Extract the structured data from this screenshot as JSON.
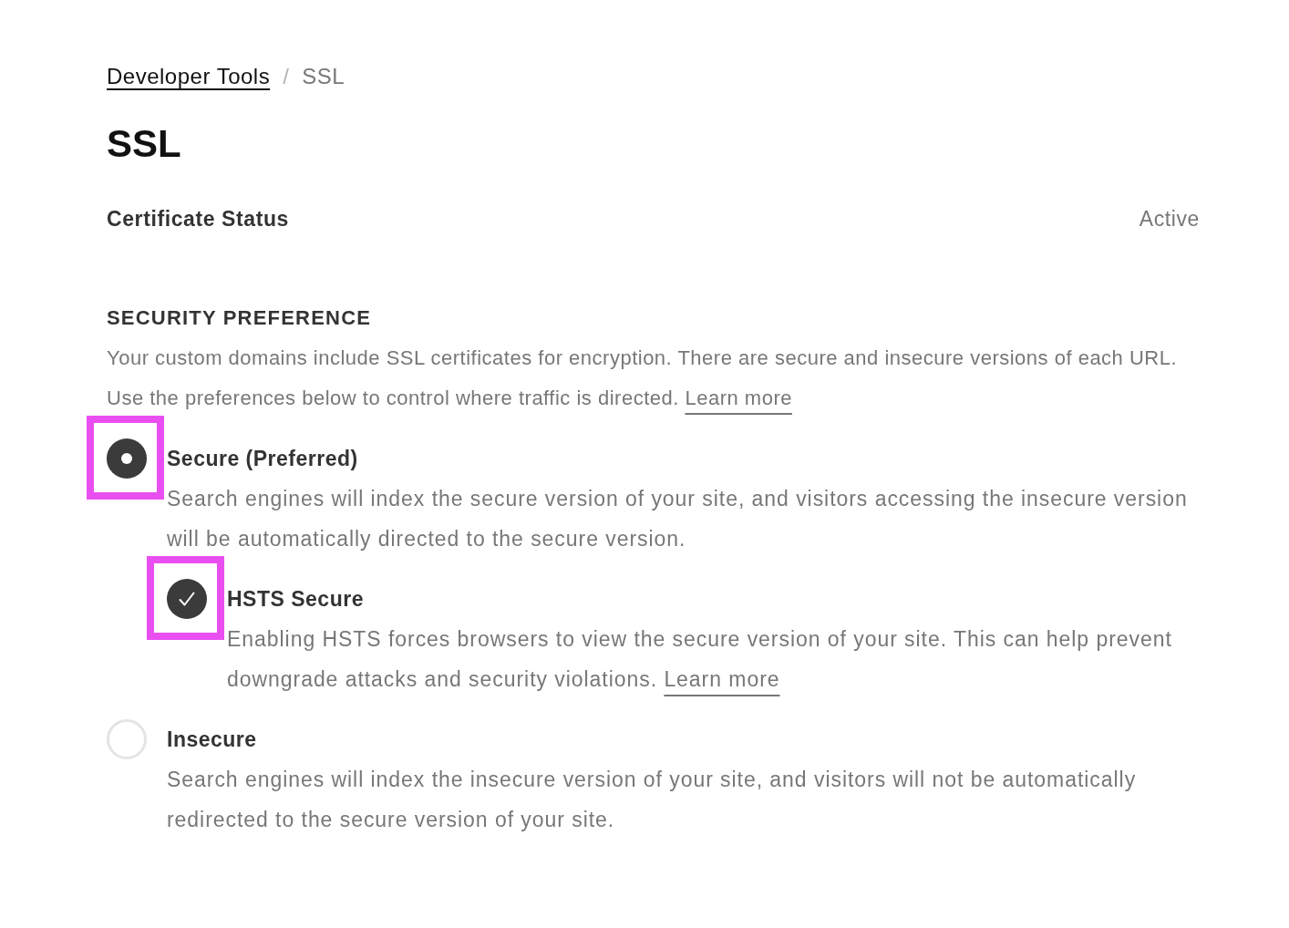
{
  "breadcrumb": {
    "separator": "/",
    "items": [
      {
        "label": "Developer Tools",
        "kind": "link"
      },
      {
        "label": "SSL",
        "kind": "current"
      }
    ]
  },
  "title": "SSL",
  "certificate_status": {
    "label": "Certificate Status",
    "value": "Active"
  },
  "security_preference": {
    "heading": "SECURITY PREFERENCE",
    "description": "Your custom domains include SSL certificates for encryption. There are secure and insecure versions of each URL. Use the preferences below to control where traffic is directed.",
    "link": "Learn more",
    "options": [
      {
        "label": "Secure (Preferred)",
        "description": "Search engines will index the secure version of your site, and visitors accessing the insecure version will be automatically directed to the secure version.",
        "selected": true,
        "highlighted": true,
        "sub_options": [
          {
            "label": "HSTS Secure",
            "description": "Enabling HSTS forces browsers to view the secure version of your site. This can help prevent downgrade attacks and security violations.",
            "link": "Learn more",
            "checked": true,
            "highlighted": true
          }
        ]
      },
      {
        "label": "Insecure",
        "description": "Search engines will index the insecure version of your site, and visitors will not be automatically redirected to the secure version of your site.",
        "selected": false,
        "highlighted": false
      }
    ]
  }
}
